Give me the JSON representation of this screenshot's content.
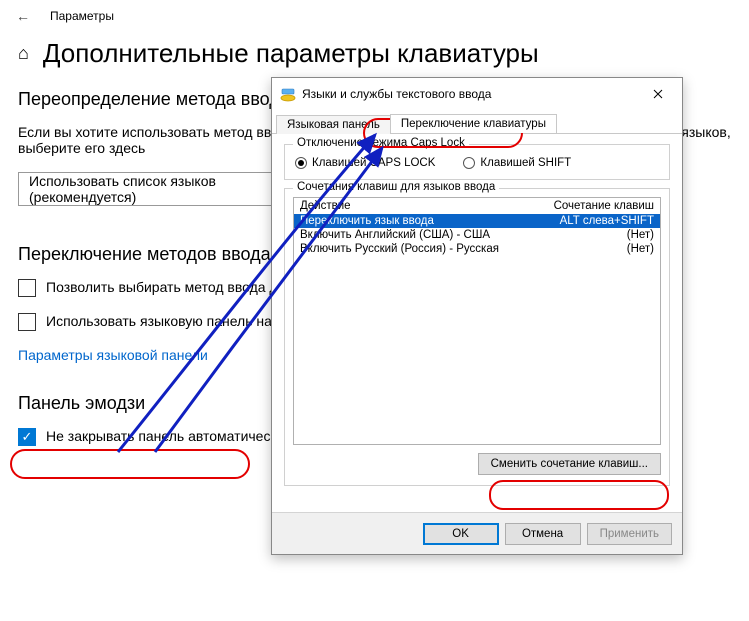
{
  "topbar": {
    "title": "Параметры"
  },
  "page": {
    "title": "Дополнительные параметры клавиатуры",
    "section1": "Переопределение метода ввода по умолчанию",
    "body1": "Если вы хотите использовать метод ввода, отличный от указанного на первом месте в вашем списке языков, выберите его здесь",
    "dropdown": "Использовать список языков (рекомендуется)",
    "section2": "Переключение методов ввода",
    "check1": "Позволить выбирать метод ввода для каждого окна приложения",
    "check2": "Использовать языковую панель на рабочем столе, если она доступна",
    "link": "Параметры языковой панели",
    "section3": "Панель эмодзи",
    "check3": "Не закрывать панель автоматически после ввода эмодзи"
  },
  "dialog": {
    "title": "Языки и службы текстового ввода",
    "tabs": {
      "lang_panel": "Языковая панель",
      "switch": "Переключение клавиатуры"
    },
    "caps_group": {
      "legend": "Отключение режима Caps Lock",
      "radio_caps": "Клавишей CAPS LOCK",
      "radio_shift": "Клавишей SHIFT"
    },
    "hotkeys_group": {
      "legend": "Сочетания клавиш для языков ввода",
      "header_action": "Действие",
      "header_keys": "Сочетание клавиш",
      "rows": [
        {
          "action": "Переключить язык ввода",
          "keys": "ALT слева+SHIFT",
          "selected": true
        },
        {
          "action": "Включить Английский (США) - США",
          "keys": "(Нет)",
          "selected": false
        },
        {
          "action": "Включить Русский (Россия) - Русская",
          "keys": "(Нет)",
          "selected": false
        }
      ],
      "change_btn": "Сменить сочетание клавиш..."
    },
    "buttons": {
      "ok": "OK",
      "cancel": "Отмена",
      "apply": "Применить"
    }
  }
}
